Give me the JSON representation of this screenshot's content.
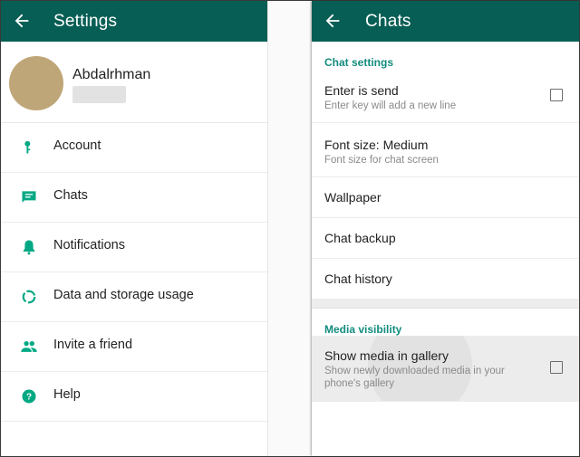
{
  "left": {
    "appbar": {
      "title": "Settings"
    },
    "profile": {
      "name": "Abdalrhman"
    },
    "menu": [
      {
        "label": "Account",
        "icon": "key-icon"
      },
      {
        "label": "Chats",
        "icon": "chat-icon"
      },
      {
        "label": "Notifications",
        "icon": "bell-icon"
      },
      {
        "label": "Data and storage usage",
        "icon": "data-usage-icon"
      },
      {
        "label": "Invite a friend",
        "icon": "people-icon"
      },
      {
        "label": "Help",
        "icon": "help-icon"
      }
    ]
  },
  "right": {
    "appbar": {
      "title": "Chats"
    },
    "chat_settings": {
      "header": "Chat settings",
      "enter_is_send": {
        "title": "Enter is send",
        "subtitle": "Enter key will add a new line",
        "checked": false
      },
      "font_size": {
        "title": "Font size: Medium",
        "subtitle": "Font size for chat screen"
      },
      "wallpaper": {
        "title": "Wallpaper"
      },
      "chat_backup": {
        "title": "Chat backup"
      },
      "chat_history": {
        "title": "Chat history"
      }
    },
    "media_visibility": {
      "header": "Media visibility",
      "show_media": {
        "title": "Show media in gallery",
        "subtitle_line1": "Show newly downloaded media in your",
        "subtitle_line2": "phone's gallery",
        "checked": false
      }
    }
  },
  "colors": {
    "appbar": "#075e54",
    "accent": "#128c7e",
    "icon": "#00a884",
    "avatar": "#bfa678"
  }
}
